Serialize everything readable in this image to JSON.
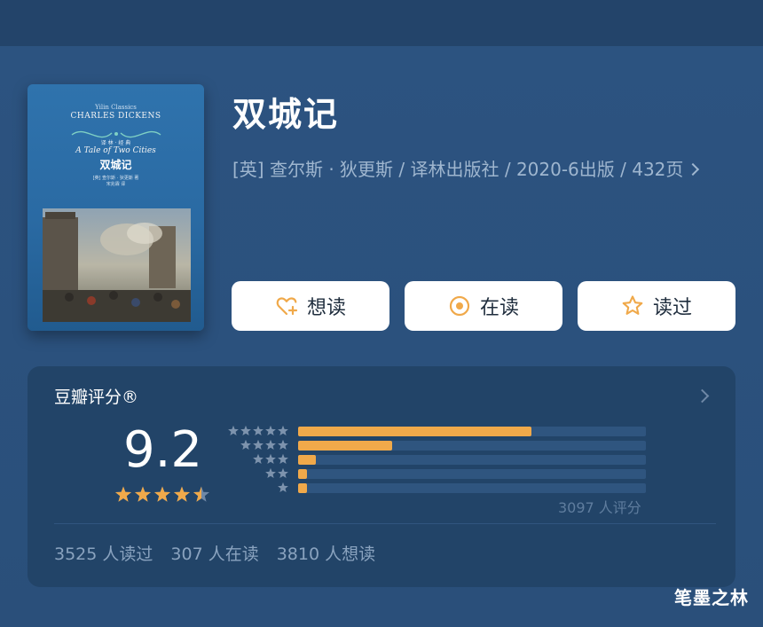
{
  "book": {
    "title": "双城记",
    "meta": "[英] 查尔斯 · 狄更斯 / 译林出版社 / 2020-6出版 / 432页",
    "cover": {
      "series": "Yilin Classics",
      "author_en": "CHARLES DICKENS",
      "label_cn": "译 林 · 经 典",
      "title_en": "A Tale of Two Cities",
      "title_cn": "双城记",
      "credit_line1": "[英] 查尔斯 · 狄更斯 著",
      "credit_line2": "宋兆霖 译"
    }
  },
  "actions": {
    "want": "想读",
    "reading": "在读",
    "read": "读过"
  },
  "rating": {
    "label": "豆瓣评分®",
    "score": "9.2",
    "stars": 4.5,
    "distribution": [
      {
        "stars": 5,
        "fraction": 0.67
      },
      {
        "stars": 4,
        "fraction": 0.27
      },
      {
        "stars": 3,
        "fraction": 0.05
      },
      {
        "stars": 2,
        "fraction": 0.02
      },
      {
        "stars": 1,
        "fraction": 0.02
      }
    ],
    "total": "3097 人评分"
  },
  "stats": {
    "read": "3525 人读过",
    "reading": "307 人在读",
    "want": "3810 人想读"
  },
  "watermark": "笔墨之林",
  "colors": {
    "accent": "#f0a94a",
    "card_bg": "#224468",
    "page_bg": "#2b4f78"
  }
}
